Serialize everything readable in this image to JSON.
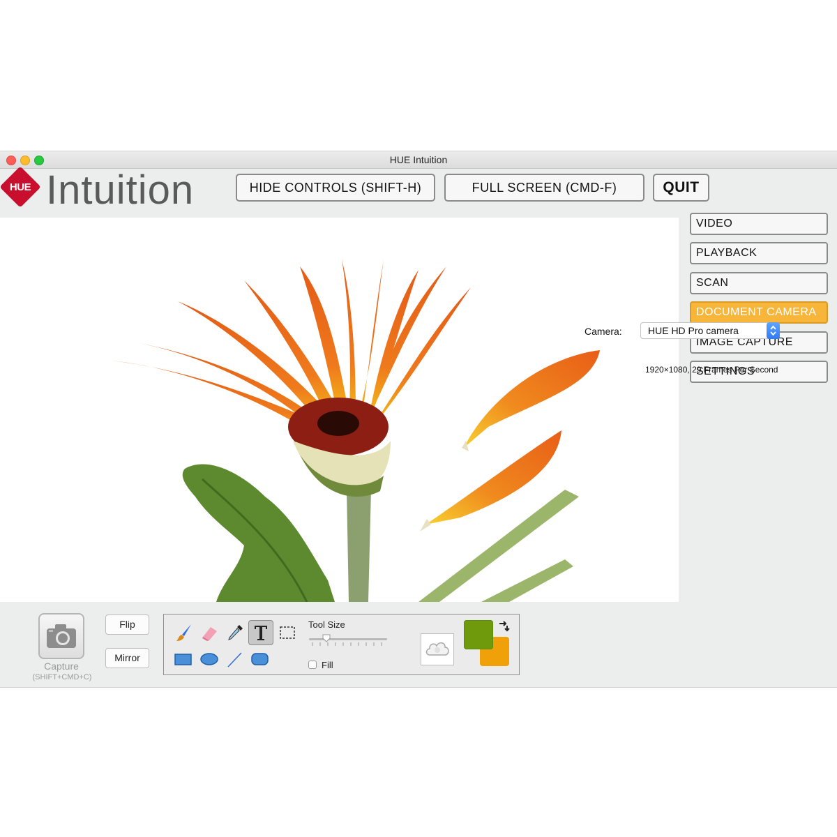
{
  "window": {
    "title": "HUE Intuition",
    "logo_badge": "HUE",
    "logo_text": "Intuition"
  },
  "toolbar": {
    "hide_controls": "HIDE CONTROLS (SHIFT-H)",
    "full_screen": "FULL SCREEN (CMD-F)",
    "quit": "QUIT"
  },
  "sidebar": {
    "items": [
      {
        "label": "VIDEO",
        "active": false
      },
      {
        "label": "PLAYBACK",
        "active": false
      },
      {
        "label": "SCAN",
        "active": false
      },
      {
        "label": "DOCUMENT CAMERA",
        "active": true
      },
      {
        "label": "IMAGE CAPTURE",
        "active": false
      },
      {
        "label": "SETTINGS",
        "active": false
      }
    ]
  },
  "bottom": {
    "capture_label": "Capture",
    "capture_hint": "(SHIFT+CMD+C)",
    "flip": "Flip",
    "mirror": "Mirror",
    "tool_size_label": "Tool Size",
    "tool_size_value": 0.25,
    "fill_label": "Fill",
    "fill_checked": false,
    "foreground_color": "#6e9a0c",
    "background_color": "#f0a10a",
    "camera_label": "Camera:",
    "camera_selected": "HUE HD Pro camera",
    "resolution": "1920×1080, 29 Frames Per Second"
  },
  "tools": [
    "paintbrush-icon",
    "eraser-icon",
    "eyedropper-icon",
    "text-icon",
    "marquee-select-icon",
    "rectangle-icon",
    "ellipse-icon",
    "line-icon",
    "rounded-rectangle-icon"
  ],
  "colors": {
    "accent_active": "#f7b53a",
    "logo_red": "#c8102e"
  }
}
